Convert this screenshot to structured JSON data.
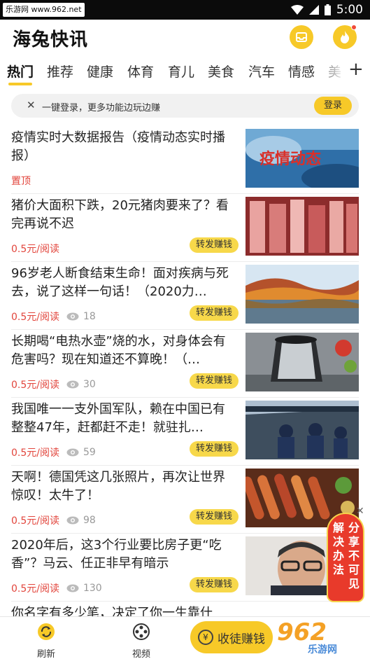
{
  "status_bar": {
    "watermark": "乐游网 www.962.net",
    "time": "5:00"
  },
  "app": {
    "title": "海兔快讯"
  },
  "tabs": [
    "热门",
    "推荐",
    "健康",
    "体育",
    "育儿",
    "美食",
    "汽车",
    "情感",
    "美"
  ],
  "login_bar": {
    "message": "一键登录，更多功能边玩边赚",
    "button": "登录"
  },
  "articles": [
    {
      "title": "疫情实时大数据报告（疫情动态实时播报）",
      "tag": "置顶",
      "thumb_text": "疫情动态"
    },
    {
      "title": "猪价大面积下跌，20元猪肉要来了？看完再说不迟",
      "price": "0.5元/阅读",
      "share": "转发赚钱"
    },
    {
      "title": "96岁老人断食结束生命！面对疾病与死去，说了这样一句话！（2020力…",
      "price": "0.5元/阅读",
      "views": "18",
      "share": "转发赚钱"
    },
    {
      "title": "长期喝“电热水壶”烧的水，对身体会有危害吗？现在知道还不算晚！（…",
      "price": "0.5元/阅读",
      "views": "30",
      "share": "转发赚钱"
    },
    {
      "title": "我国唯一一支外国军队，赖在中国已有整整47年，赶都赶不走！就驻扎…",
      "price": "0.5元/阅读",
      "views": "59",
      "share": "转发赚钱"
    },
    {
      "title": "天啊！德国凭这几张照片，再次让世界惊叹！太牛了！",
      "price": "0.5元/阅读",
      "views": "98",
      "share": "转发赚钱"
    },
    {
      "title": "2020年后，这3个行业要比房子更“吃香”？马云、任正非早有暗示",
      "price": "0.5元/阅读",
      "views": "130",
      "share": "转发赚钱"
    },
    {
      "title": "你名字有多少笔，决定了你一生靠什"
    }
  ],
  "promo": {
    "text": [
      "解",
      "分",
      "决",
      "享",
      "办",
      "不",
      "法",
      "可",
      "",
      "见"
    ]
  },
  "bottom_nav": {
    "refresh": "刷新",
    "video": "视频",
    "earn": "收徒赚钱",
    "coin_symbol": "¥"
  },
  "logo": {
    "big": "962",
    "small": "乐游网"
  },
  "colors": {
    "accent": "#f7c928",
    "price": "#e2453c",
    "promo": "#e83a2b"
  }
}
